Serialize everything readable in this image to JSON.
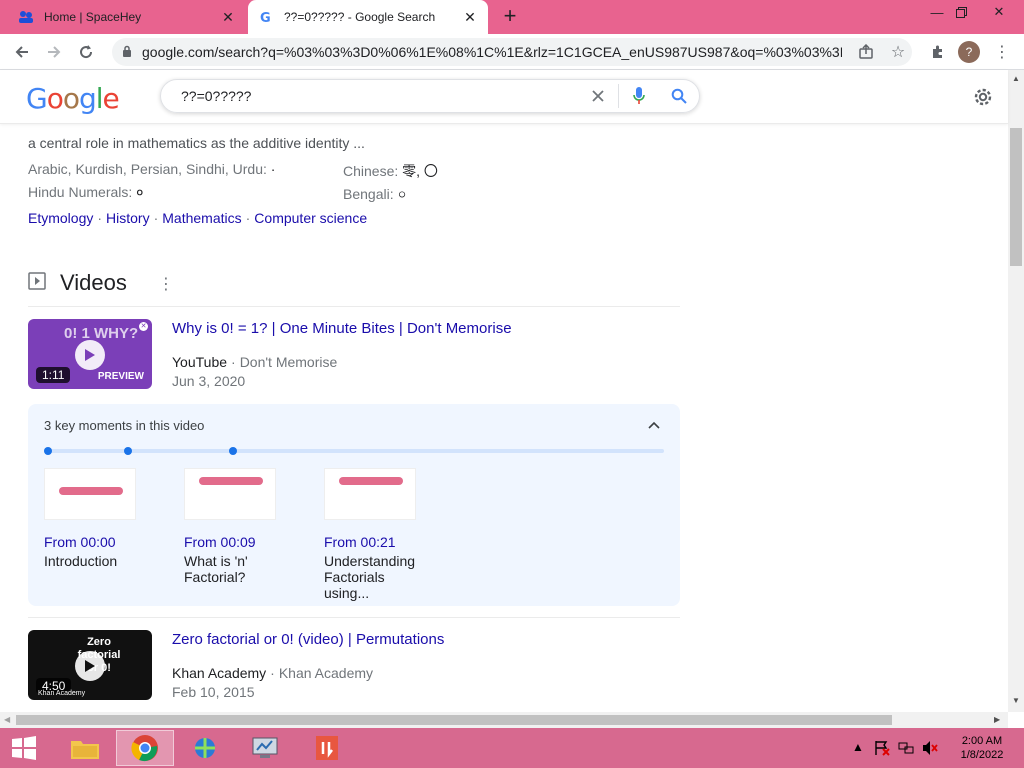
{
  "browser": {
    "tabs": [
      {
        "title": "Home | SpaceHey",
        "active": false
      },
      {
        "title": "??=0????? - Google Search",
        "active": true
      }
    ],
    "url": "google.com/search?q=%03%03%3D0%06%1E%08%1C%1E&rlz=1C1GCEA_enUS987US987&oq=%03%03%3D0...",
    "profile_initial": "?"
  },
  "google": {
    "logo": "Google",
    "query": "??=0?????"
  },
  "knowledge": {
    "snippet_line": "a central role in mathematics as the additive identity ...",
    "numerals": [
      {
        "label": "Arabic, Kurdish, Persian, Sindhi, Urdu:",
        "value": "·"
      },
      {
        "label": "Chinese:",
        "value": "零, 〇"
      },
      {
        "label": "Hindu Numerals:",
        "value": "०"
      },
      {
        "label": "Bengali:",
        "value": "০"
      }
    ],
    "links": [
      "Etymology",
      "History",
      "Mathematics",
      "Computer science"
    ]
  },
  "videos": {
    "heading": "Videos",
    "items": [
      {
        "title": "Why is 0! = 1? | One Minute Bites | Don't Memorise",
        "platform": "YouTube",
        "channel": "Don't Memorise",
        "date": "Jun 3, 2020",
        "duration": "1:11",
        "preview_label": "PREVIEW",
        "thumb_text": "0! 1 WHY?"
      },
      {
        "title": "Zero factorial or 0! (video) | Permutations",
        "platform": "Khan Academy",
        "channel": "Khan Academy",
        "date": "Feb 10, 2015",
        "duration": "4:50",
        "thumb_text": "Zero factorial or 0!",
        "thumb_brand": "Khan Academy"
      }
    ],
    "key_moments": {
      "title": "3 key moments in this video",
      "items": [
        {
          "from": "From 00:00",
          "label": "Introduction"
        },
        {
          "from": "From 00:09",
          "label": "What is 'n' Factorial?"
        },
        {
          "from": "From 00:21",
          "label": "Understanding Factorials using..."
        }
      ]
    }
  },
  "taskbar": {
    "time": "2:00 AM",
    "date": "1/8/2022"
  },
  "colors": {
    "tabstrip": "#e8638f",
    "taskbar": "#d7698f",
    "link": "#1a0dab",
    "accent": "#1a73e8"
  }
}
